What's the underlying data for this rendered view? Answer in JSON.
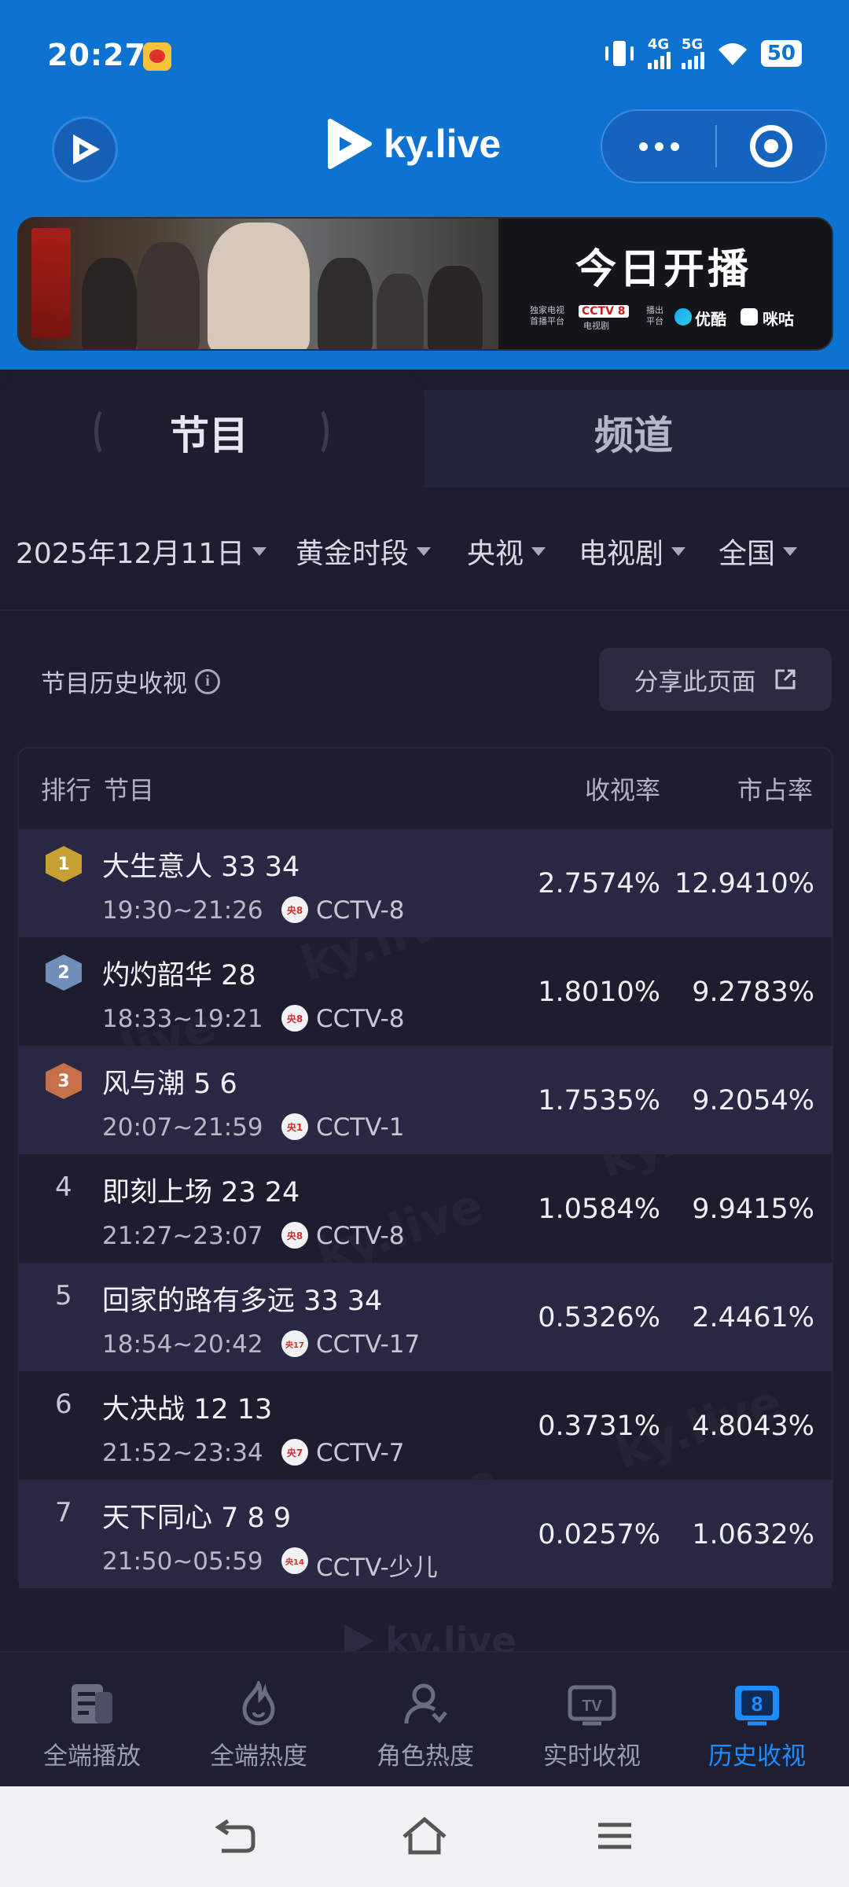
{
  "status_bar": {
    "time": "20:27",
    "net1": "4G",
    "net2": "5G",
    "battery": "50"
  },
  "header": {
    "brand": "ky.live"
  },
  "banner": {
    "headline": "今日开播",
    "note1": "独家电视",
    "note2": "首播平台",
    "cctv": "CCTV 8",
    "cctv_sub": "电视剧",
    "note3": "播出",
    "note4": "平台",
    "youku": "优酷",
    "migu": "咪咕"
  },
  "tabs": [
    {
      "label": "节目",
      "active": true
    },
    {
      "label": "频道",
      "active": false
    }
  ],
  "filters": [
    {
      "label": "2025年12月11日"
    },
    {
      "label": "黄金时段"
    },
    {
      "label": "央视"
    },
    {
      "label": "电视剧"
    },
    {
      "label": "全国"
    }
  ],
  "section": {
    "title": "节目历史收视",
    "share_label": "分享此页面"
  },
  "table": {
    "headers": {
      "rank": "排行",
      "program": "节目",
      "rating": "收视率",
      "share": "市占率"
    },
    "rows": [
      {
        "rank": "1",
        "title": "大生意人 33 34",
        "time": "19:30~21:26",
        "channel_icon": "央8",
        "channel": "CCTV-8",
        "rating": "2.7574%",
        "share": "12.9410%"
      },
      {
        "rank": "2",
        "title": "灼灼韶华 28",
        "time": "18:33~19:21",
        "channel_icon": "央8",
        "channel": "CCTV-8",
        "rating": "1.8010%",
        "share": "9.2783%"
      },
      {
        "rank": "3",
        "title": "风与潮 5 6",
        "time": "20:07~21:59",
        "channel_icon": "央1",
        "channel": "CCTV-1",
        "rating": "1.7535%",
        "share": "9.2054%"
      },
      {
        "rank": "4",
        "title": "即刻上场 23 24",
        "time": "21:27~23:07",
        "channel_icon": "央8",
        "channel": "CCTV-8",
        "rating": "1.0584%",
        "share": "9.9415%"
      },
      {
        "rank": "5",
        "title": "回家的路有多远 33 34",
        "time": "18:54~20:42",
        "channel_icon": "央17",
        "channel": "CCTV-17",
        "rating": "0.5326%",
        "share": "2.4461%"
      },
      {
        "rank": "6",
        "title": "大决战 12 13",
        "time": "21:52~23:34",
        "channel_icon": "央7",
        "channel": "CCTV-7",
        "rating": "0.3731%",
        "share": "4.8043%"
      },
      {
        "rank": "7",
        "title": "天下同心 7 8 9",
        "time": "21:50~05:59",
        "channel_icon": "央14",
        "channel": "CCTV-少儿",
        "rating": "0.0257%",
        "share": "1.0632%"
      }
    ]
  },
  "bottom_nav": [
    {
      "label": "全端播放",
      "icon": "document-icon"
    },
    {
      "label": "全端热度",
      "icon": "flame-icon"
    },
    {
      "label": "角色热度",
      "icon": "user-icon"
    },
    {
      "label": "实时收视",
      "icon": "tv-icon"
    },
    {
      "label": "历史收视",
      "icon": "history-icon",
      "active": true
    }
  ],
  "colors": {
    "accent": "#1d8cff",
    "header_bg": "#0e72d0",
    "panel_bg": "#1e1d2f",
    "gold": "#c9a033",
    "silver": "#6f8fb8",
    "bronze": "#c67047"
  }
}
